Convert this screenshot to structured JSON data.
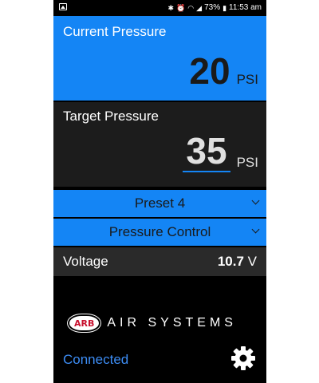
{
  "status_bar": {
    "battery": "73%",
    "time": "11:53 am",
    "icons": [
      "image-icon",
      "bluetooth-icon",
      "alarm-icon",
      "wifi-icon",
      "signal-icon",
      "battery-icon"
    ]
  },
  "current_pressure": {
    "label": "Current Pressure",
    "value": "20",
    "unit": "PSI"
  },
  "target_pressure": {
    "label": "Target Pressure",
    "value": "35",
    "unit": "PSI"
  },
  "preset_dropdown": {
    "selected": "Preset 4"
  },
  "mode_dropdown": {
    "selected": "Pressure Control"
  },
  "voltage": {
    "label": "Voltage",
    "value": "10.7",
    "unit": "V"
  },
  "logo": {
    "badge": "ARB",
    "text": "AIR SYSTEMS"
  },
  "connection": {
    "status": "Connected"
  },
  "colors": {
    "accent": "#1485f5",
    "panel_dark": "#1c1c1c",
    "voltage_bg": "#2a2a2a",
    "status_text": "#3d8df5",
    "logo_red": "#c8102e"
  }
}
